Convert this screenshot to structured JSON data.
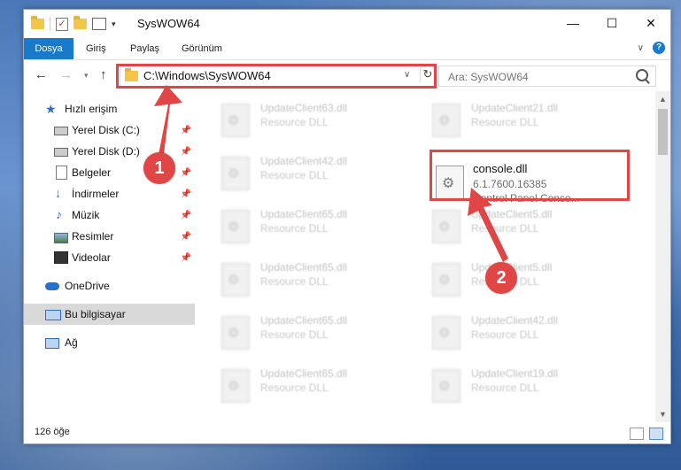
{
  "window": {
    "title": "SysWOW64",
    "controls": {
      "minimize": "—",
      "maximize": "☐",
      "close": "✕"
    }
  },
  "ribbon": {
    "tabs": [
      "Dosya",
      "Giriş",
      "Paylaş",
      "Görünüm"
    ],
    "help": "?"
  },
  "nav": {
    "address": "C:\\Windows\\SysWOW64",
    "search_placeholder": "Ara: SysWOW64"
  },
  "sidebar": {
    "quick_access": "Hızlı erişim",
    "items": [
      "Yerel Disk (C:)",
      "Yerel Disk (D:)",
      "Belgeler",
      "İndirmeler",
      "Müzik",
      "Resimler",
      "Videolar"
    ],
    "onedrive": "OneDrive",
    "this_pc": "Bu bilgisayar",
    "network": "Ağ"
  },
  "files": {
    "left": [
      {
        "name": "UpdateClient63.dll",
        "desc": "Resource DLL"
      },
      {
        "name": "UpdateClient42.dll",
        "desc": "Resource DLL"
      },
      {
        "name": "UpdateClient65.dll",
        "desc": "Resource DLL"
      },
      {
        "name": "UpdateClient65.dll",
        "desc": "Resource DLL"
      },
      {
        "name": "UpdateClient65.dll",
        "desc": "Resource DLL"
      },
      {
        "name": "UpdateClient65.dll",
        "desc": "Resource DLL"
      }
    ],
    "right": [
      {
        "name": "UpdateClient21.dll",
        "desc": "Resource DLL"
      },
      {
        "name": "UpdateClient5.dll",
        "desc": "Resource DLL"
      },
      {
        "name": "UpdateClient5.dll",
        "desc": "Resource DLL"
      },
      {
        "name": "UpdateClient42.dll",
        "desc": "Resource DLL"
      },
      {
        "name": "UpdateClient19.dll",
        "desc": "Resource DLL"
      }
    ],
    "highlighted": {
      "name": "console.dll",
      "version": "6.1.7600.16385",
      "desc": "Control Panel Conso..."
    }
  },
  "status": {
    "count": "126 öğe"
  },
  "annotations": {
    "step1": "1",
    "step2": "2",
    "color": "#e04646"
  }
}
